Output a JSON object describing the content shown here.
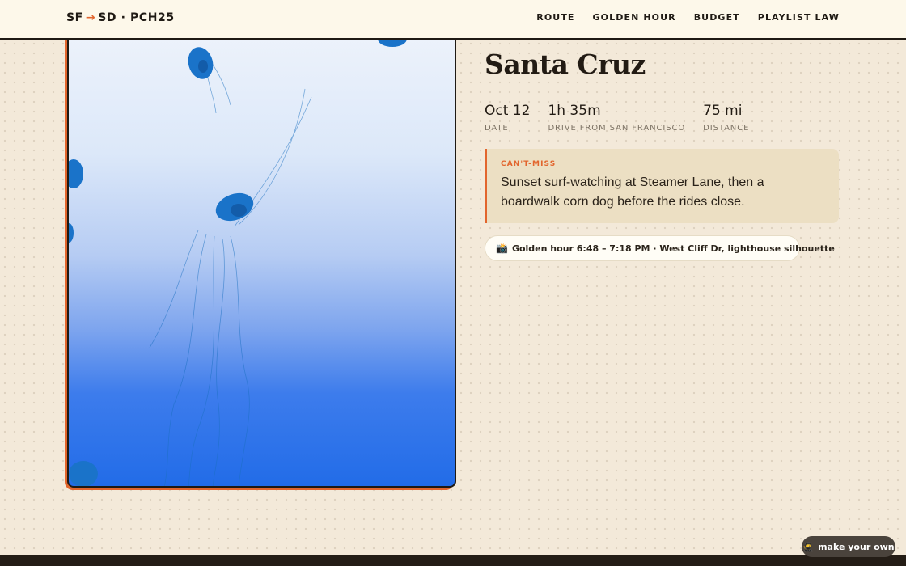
{
  "brand": {
    "from": "SF",
    "arrow": "→",
    "to": "SD · PCH25"
  },
  "nav": [
    "ROUTE",
    "GOLDEN HOUR",
    "BUDGET",
    "PLAYLIST LAW"
  ],
  "stop": {
    "title": "Santa Cruz",
    "stats": [
      {
        "value": "Oct 12",
        "label": "DATE"
      },
      {
        "value": "1h 35m",
        "label": "DRIVE FROM SAN FRANCISCO"
      },
      {
        "value": "75 mi",
        "label": "DISTANCE"
      }
    ],
    "callout": {
      "tag": "CAN'T-MISS",
      "text": "Sunset surf-watching at Steamer Lane, then a boardwalk corn dog before the rides close."
    },
    "golden_hour_pill": {
      "icon": "📸",
      "text": "Golden hour 6:48 – 7:18 PM · West Cliff Dr, lighthouse silhouette"
    }
  },
  "fab": {
    "icon": "🥷",
    "label": "make your own"
  },
  "colors": {
    "accent": "#e2652d",
    "ink": "#1f1a14",
    "paper": "#f3e9d9"
  }
}
